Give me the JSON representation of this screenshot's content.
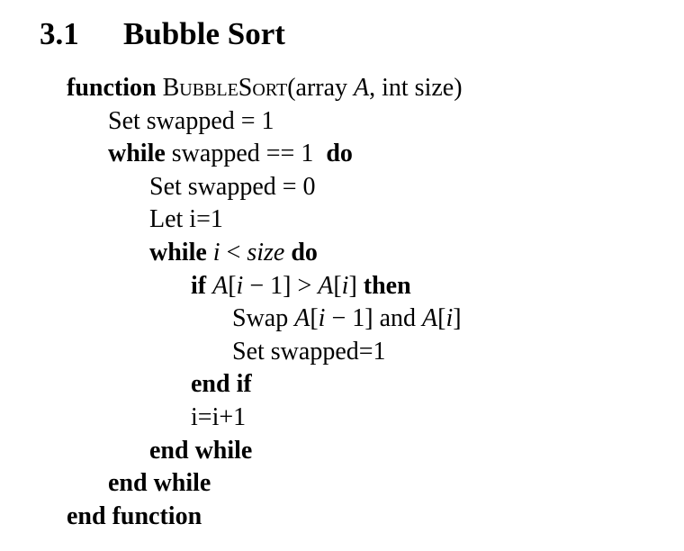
{
  "section": {
    "number": "3.1",
    "title": "Bubble Sort"
  },
  "algorithm": {
    "lines": [
      {
        "indent": 0,
        "parts": [
          {
            "t": "function",
            "s": "kw"
          },
          {
            "t": " ",
            "s": ""
          },
          {
            "t": "BubbleSort",
            "s": "sc"
          },
          {
            "t": "(array ",
            "s": ""
          },
          {
            "t": "A",
            "s": "it"
          },
          {
            "t": ", int size)",
            "s": ""
          }
        ]
      },
      {
        "indent": 1,
        "parts": [
          {
            "t": "Set swapped = 1",
            "s": ""
          }
        ]
      },
      {
        "indent": 1,
        "parts": [
          {
            "t": "while",
            "s": "kw"
          },
          {
            "t": " swapped == 1  ",
            "s": ""
          },
          {
            "t": "do",
            "s": "kw"
          }
        ]
      },
      {
        "indent": 2,
        "parts": [
          {
            "t": "Set swapped = 0",
            "s": ""
          }
        ]
      },
      {
        "indent": 2,
        "parts": [
          {
            "t": "Let i=1",
            "s": ""
          }
        ]
      },
      {
        "indent": 2,
        "parts": [
          {
            "t": "while",
            "s": "kw"
          },
          {
            "t": " ",
            "s": ""
          },
          {
            "t": "i",
            "s": "it"
          },
          {
            "t": " < ",
            "s": ""
          },
          {
            "t": "size",
            "s": "it"
          },
          {
            "t": " ",
            "s": ""
          },
          {
            "t": "do",
            "s": "kw"
          }
        ]
      },
      {
        "indent": 3,
        "parts": [
          {
            "t": "if",
            "s": "kw"
          },
          {
            "t": " ",
            "s": ""
          },
          {
            "t": "A",
            "s": "it"
          },
          {
            "t": "[",
            "s": ""
          },
          {
            "t": "i",
            "s": "it"
          },
          {
            "t": " − 1] > ",
            "s": ""
          },
          {
            "t": "A",
            "s": "it"
          },
          {
            "t": "[",
            "s": ""
          },
          {
            "t": "i",
            "s": "it"
          },
          {
            "t": "] ",
            "s": ""
          },
          {
            "t": "then",
            "s": "kw"
          }
        ]
      },
      {
        "indent": 4,
        "parts": [
          {
            "t": "Swap ",
            "s": ""
          },
          {
            "t": "A",
            "s": "it"
          },
          {
            "t": "[",
            "s": ""
          },
          {
            "t": "i",
            "s": "it"
          },
          {
            "t": " − 1] and ",
            "s": ""
          },
          {
            "t": "A",
            "s": "it"
          },
          {
            "t": "[",
            "s": ""
          },
          {
            "t": "i",
            "s": "it"
          },
          {
            "t": "]",
            "s": ""
          }
        ]
      },
      {
        "indent": 4,
        "parts": [
          {
            "t": "Set swapped=1",
            "s": ""
          }
        ]
      },
      {
        "indent": 3,
        "parts": [
          {
            "t": "end if",
            "s": "kw"
          }
        ]
      },
      {
        "indent": 3,
        "parts": [
          {
            "t": "i=i+1",
            "s": ""
          }
        ]
      },
      {
        "indent": 2,
        "parts": [
          {
            "t": "end while",
            "s": "kw"
          }
        ]
      },
      {
        "indent": 1,
        "parts": [
          {
            "t": "end while",
            "s": "kw"
          }
        ]
      },
      {
        "indent": 0,
        "parts": [
          {
            "t": "end function",
            "s": "kw"
          }
        ]
      }
    ]
  }
}
